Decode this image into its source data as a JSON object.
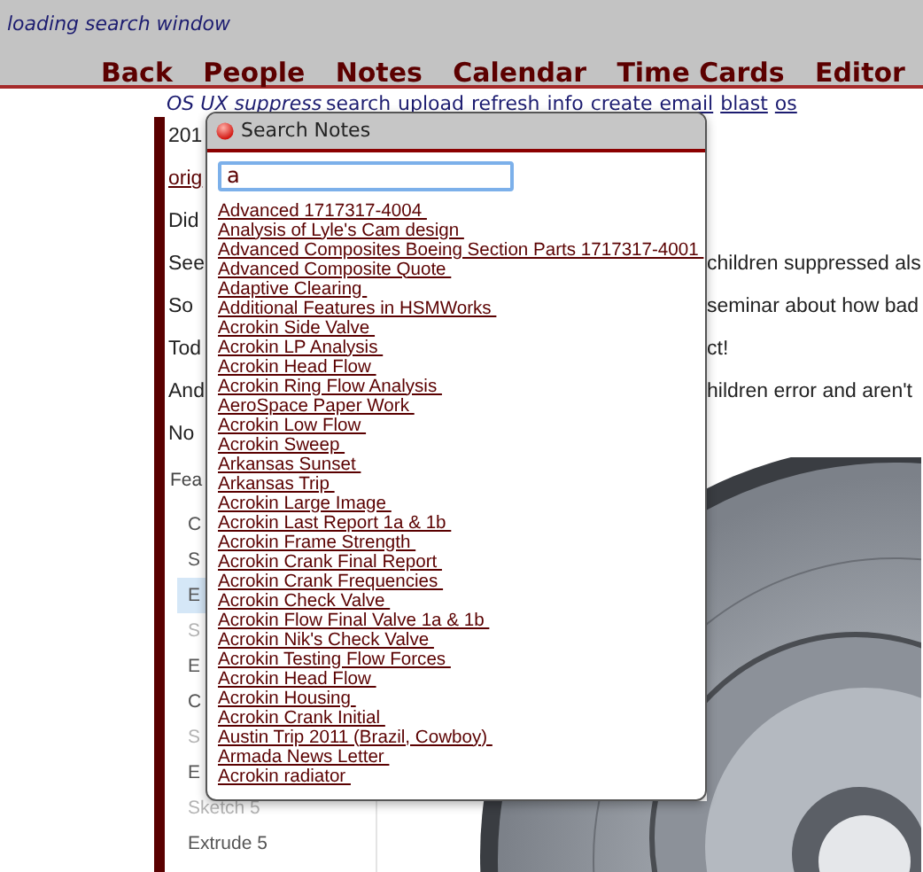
{
  "status_text": "loading search window",
  "nav": [
    "Back",
    "People",
    "Notes",
    "Calendar",
    "Time Cards",
    "Editor"
  ],
  "mode_label": "OS UX suppress",
  "toolbar_links": [
    "search",
    "upload",
    "refresh",
    "info",
    "create",
    "email",
    "blast",
    "os"
  ],
  "note_lines": [
    {
      "kind": "text",
      "start": "201"
    },
    {
      "kind": "link",
      "start": "orig"
    },
    {
      "kind": "text",
      "start": "Did"
    },
    {
      "kind": "text",
      "start": "See",
      "end": "children suppressed als"
    },
    {
      "kind": "text",
      "start": "So",
      "end": "seminar about how bad"
    },
    {
      "kind": "text",
      "start": "Tod",
      "end": "ct!"
    },
    {
      "kind": "text",
      "start": "And",
      "end": "hildren error and aren't"
    },
    {
      "kind": "text",
      "start": "No"
    }
  ],
  "embedded_screenshot": {
    "heading": "Fea",
    "features": [
      {
        "label": "C",
        "selected": false,
        "suppressed": false
      },
      {
        "label": "S",
        "selected": false,
        "suppressed": false
      },
      {
        "label": "E",
        "selected": true,
        "suppressed": false
      },
      {
        "label": "S",
        "selected": false,
        "suppressed": true
      },
      {
        "label": "E",
        "selected": false,
        "suppressed": false
      },
      {
        "label": "C",
        "selected": false,
        "suppressed": false
      },
      {
        "label": "S",
        "selected": false,
        "suppressed": true
      },
      {
        "label": "E",
        "selected": false,
        "suppressed": false
      },
      {
        "label": "Sketch 5",
        "selected": false,
        "suppressed": true
      },
      {
        "label": "Extrude 5",
        "selected": false,
        "suppressed": false
      }
    ]
  },
  "search_dialog": {
    "title": "Search Notes",
    "query": "a",
    "results": [
      "Advanced 1717317-4004",
      "Analysis of Lyle's Cam design",
      "Advanced Composites Boeing Section Parts 1717317-4001",
      "Advanced Composite Quote",
      "Adaptive Clearing",
      "Additional Features in HSMWorks",
      "Acrokin Side Valve",
      "Acrokin LP Analysis",
      "Acrokin Head Flow",
      "Acrokin Ring Flow Analysis",
      "AeroSpace Paper Work",
      "Acrokin Low Flow",
      "Acrokin Sweep",
      "Arkansas Sunset",
      "Arkansas Trip",
      "Acrokin Large Image",
      "Acrokin Last Report 1a & 1b",
      "Acrokin Frame Strength",
      "Acrokin Crank Final Report",
      "Acrokin Crank Frequencies",
      "Acrokin Check Valve",
      "Acrokin Flow Final Valve 1a & 1b",
      "Acrokin Nik's Check Valve",
      "Acrokin Testing Flow Forces",
      "Acrokin Head Flow",
      "Acrokin Housing",
      "Acrokin Crank Initial",
      "Austin Trip 2011 (Brazil, Cowboy)",
      "Armada News Letter",
      "Acrokin radiator"
    ]
  }
}
